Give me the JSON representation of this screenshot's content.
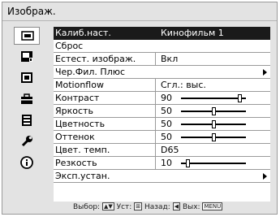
{
  "title": "Изображ.",
  "sidebar": {
    "icons": [
      {
        "name": "picture-icon",
        "selected": true
      },
      {
        "name": "advanced-picture-icon",
        "selected": false
      },
      {
        "name": "screen-icon",
        "selected": false
      },
      {
        "name": "setup-icon",
        "selected": false
      },
      {
        "name": "function-icon",
        "selected": false
      },
      {
        "name": "installation-icon",
        "selected": false
      },
      {
        "name": "information-icon",
        "selected": false
      }
    ]
  },
  "menu": {
    "rows": [
      {
        "label": "Калиб.наст.",
        "value": "Кинофильм 1"
      },
      {
        "label": "Сброс",
        "value": ""
      },
      {
        "label": "Естест. изображ.",
        "value": "Вкл"
      },
      {
        "label": "Чер.Фил. Плюс",
        "value": ""
      },
      {
        "label": "Motionflow",
        "value": "Сгл.: выс."
      },
      {
        "label": "Контраст",
        "value": "90",
        "level": 0.9
      },
      {
        "label": "Яркость",
        "value": "50",
        "level": 0.5
      },
      {
        "label": "Цветность",
        "value": "50",
        "level": 0.5
      },
      {
        "label": "Оттенок",
        "value": "50",
        "level": 0.5
      },
      {
        "label": "Цвет. темп.",
        "value": "D65"
      },
      {
        "label": "Резкость",
        "value": "10",
        "level": 0.1
      },
      {
        "label": "Эксп.устан.",
        "value": ""
      }
    ]
  },
  "hints": {
    "select_label": "Выбор:",
    "set_label": "Уст:",
    "back_label": "Назад:",
    "exit_label": "Вых:",
    "menu_key": "MENU"
  }
}
